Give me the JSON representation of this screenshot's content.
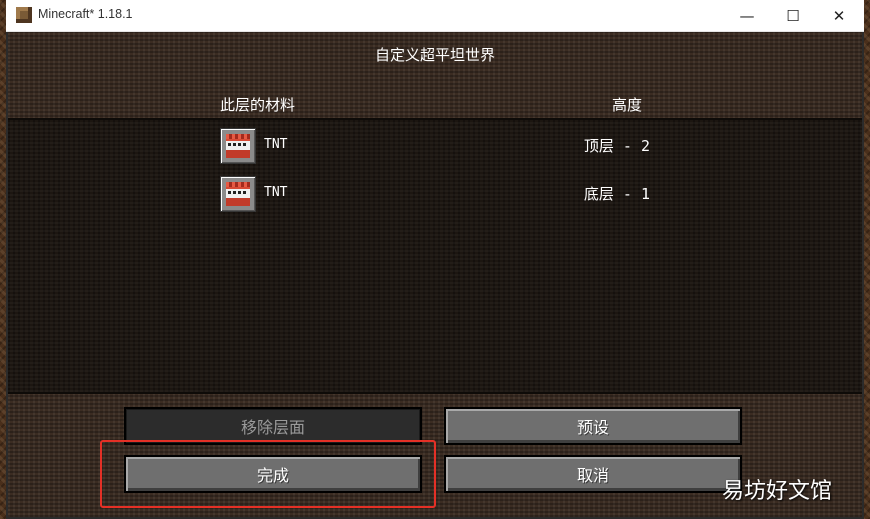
{
  "window": {
    "title": "Minecraft* 1.18.1",
    "controls": {
      "minimize": "—",
      "maximize": "☐",
      "close": "✕"
    }
  },
  "screen": {
    "title": "自定义超平坦世界",
    "columns": {
      "material": "此层的材料",
      "height": "高度"
    }
  },
  "layers": [
    {
      "name": "TNT",
      "height": "顶层 - 2",
      "icon": "tnt-block-icon"
    },
    {
      "name": "TNT",
      "height": "底层 - 1",
      "icon": "tnt-block-icon"
    }
  ],
  "buttons": {
    "remove_layer": "移除层面",
    "presets": "预设",
    "done": "完成",
    "cancel": "取消"
  },
  "annotation": {
    "color": "#e53026"
  },
  "watermark": "易坊好文馆"
}
